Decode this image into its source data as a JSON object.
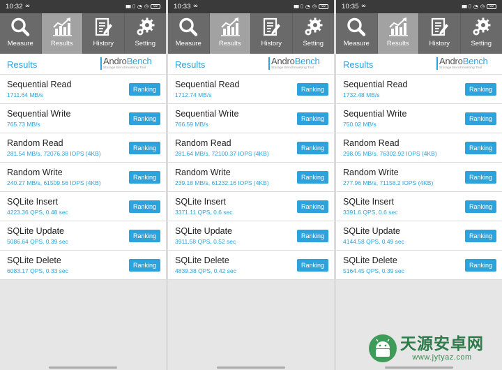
{
  "toolbar_labels": {
    "measure": "Measure",
    "results": "Results",
    "history": "History",
    "setting": "Setting"
  },
  "results_title": "Results",
  "logo": {
    "andro": "Andro",
    "bench": "Bench",
    "subtitle": "Storage Benchmarking Tool"
  },
  "ranking_label": "Ranking",
  "status_icons": {
    "signal": "ᐱᐱᐱ",
    "wifi": "wifi-icon",
    "battery": "92"
  },
  "panels": [
    {
      "time": "10:32",
      "rows": [
        {
          "name": "Sequential Read",
          "value": "1711.64 MB/s"
        },
        {
          "name": "Sequential Write",
          "value": "765.73 MB/s"
        },
        {
          "name": "Random Read",
          "value": "281.54 MB/s, 72076.38 IOPS (4KB)"
        },
        {
          "name": "Random Write",
          "value": "240.27 MB/s, 61509.56 IOPS (4KB)"
        },
        {
          "name": "SQLite Insert",
          "value": "4223.36 QPS, 0.48 sec"
        },
        {
          "name": "SQLite Update",
          "value": "5086.64 QPS, 0.39 sec"
        },
        {
          "name": "SQLite Delete",
          "value": "6083.17 QPS, 0.33 sec"
        }
      ]
    },
    {
      "time": "10:33",
      "rows": [
        {
          "name": "Sequential Read",
          "value": "1712.74 MB/s"
        },
        {
          "name": "Sequential Write",
          "value": "766.59 MB/s"
        },
        {
          "name": "Random Read",
          "value": "281.64 MB/s, 72100.37 IOPS (4KB)"
        },
        {
          "name": "Random Write",
          "value": "239.18 MB/s, 61232.16 IOPS (4KB)"
        },
        {
          "name": "SQLite Insert",
          "value": "3371.11 QPS, 0.6 sec"
        },
        {
          "name": "SQLite Update",
          "value": "3911.58 QPS, 0.52 sec"
        },
        {
          "name": "SQLite Delete",
          "value": "4839.38 QPS, 0.42 sec"
        }
      ]
    },
    {
      "time": "10:35",
      "rows": [
        {
          "name": "Sequential Read",
          "value": "1732.48 MB/s"
        },
        {
          "name": "Sequential Write",
          "value": "750.02 MB/s"
        },
        {
          "name": "Random Read",
          "value": "298.05 MB/s, 76302.92 IOPS (4KB)"
        },
        {
          "name": "Random Write",
          "value": "277.96 MB/s, 71158.2 IOPS (4KB)"
        },
        {
          "name": "SQLite Insert",
          "value": "3391.6 QPS, 0.6 sec"
        },
        {
          "name": "SQLite Update",
          "value": "4144.58 QPS, 0.49 sec"
        },
        {
          "name": "SQLite Delete",
          "value": "5164.45 QPS, 0.39 sec"
        }
      ]
    }
  ],
  "watermark": {
    "cn": "天源安卓网",
    "url": "www.jytyaz.com"
  },
  "colors": {
    "accent": "#2ca3dc",
    "toolbar": "#6a6a6a",
    "toolbar_active": "#a2a2a2",
    "statusbar": "#3a3a3a"
  }
}
